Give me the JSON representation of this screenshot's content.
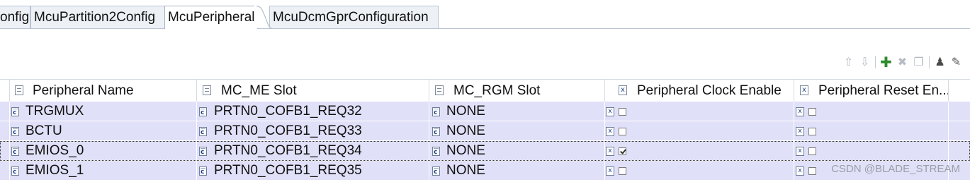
{
  "tabs": [
    {
      "label": "onfig",
      "active": false
    },
    {
      "label": "McuPartition2Config",
      "active": false
    },
    {
      "label": "McuPeripheral",
      "active": true
    },
    {
      "label": "McuDcmGprConfiguration",
      "active": false
    }
  ],
  "toolbar": {
    "buttons": [
      {
        "name": "move-up-icon",
        "glyph": "⇧"
      },
      {
        "name": "move-down-icon",
        "glyph": "⇩"
      },
      {
        "name": "add-icon",
        "glyph": "✚"
      },
      {
        "name": "remove-icon",
        "glyph": "✖"
      },
      {
        "name": "copy-icon",
        "glyph": "❐"
      },
      {
        "name": "person-icon",
        "glyph": "♟"
      },
      {
        "name": "edit-icon",
        "glyph": "✎"
      }
    ]
  },
  "table": {
    "columns": [
      {
        "label": "Peripheral Name",
        "icon": "text-field-icon"
      },
      {
        "label": "MC_ME Slot",
        "icon": "text-field-icon"
      },
      {
        "label": "MC_RGM Slot",
        "icon": "text-field-icon"
      },
      {
        "label": "Peripheral Clock Enable",
        "icon": "boolean-icon"
      },
      {
        "label": "Peripheral Reset En...",
        "icon": "boolean-icon"
      }
    ],
    "rows": [
      {
        "name": "TRGMUX",
        "me_slot": "PRTN0_COFB1_REQ32",
        "rgm_slot": "NONE",
        "clock_enable": false,
        "reset_enable": false,
        "selected": false
      },
      {
        "name": "BCTU",
        "me_slot": "PRTN0_COFB1_REQ33",
        "rgm_slot": "NONE",
        "clock_enable": false,
        "reset_enable": false,
        "selected": false
      },
      {
        "name": "EMIOS_0",
        "me_slot": "PRTN0_COFB1_REQ34",
        "rgm_slot": "NONE",
        "clock_enable": true,
        "reset_enable": false,
        "selected": true
      },
      {
        "name": "EMIOS_1",
        "me_slot": "PRTN0_COFB1_REQ35",
        "rgm_slot": "NONE",
        "clock_enable": false,
        "reset_enable": false,
        "selected": false
      }
    ]
  },
  "watermark": "CSDN @BLADE_STREAM",
  "colors": {
    "row_background": "#e0e0f8",
    "tab_inactive": "#edf1f6",
    "tab_border": "#b9c4d4",
    "add_button": "#2e8b2e"
  }
}
